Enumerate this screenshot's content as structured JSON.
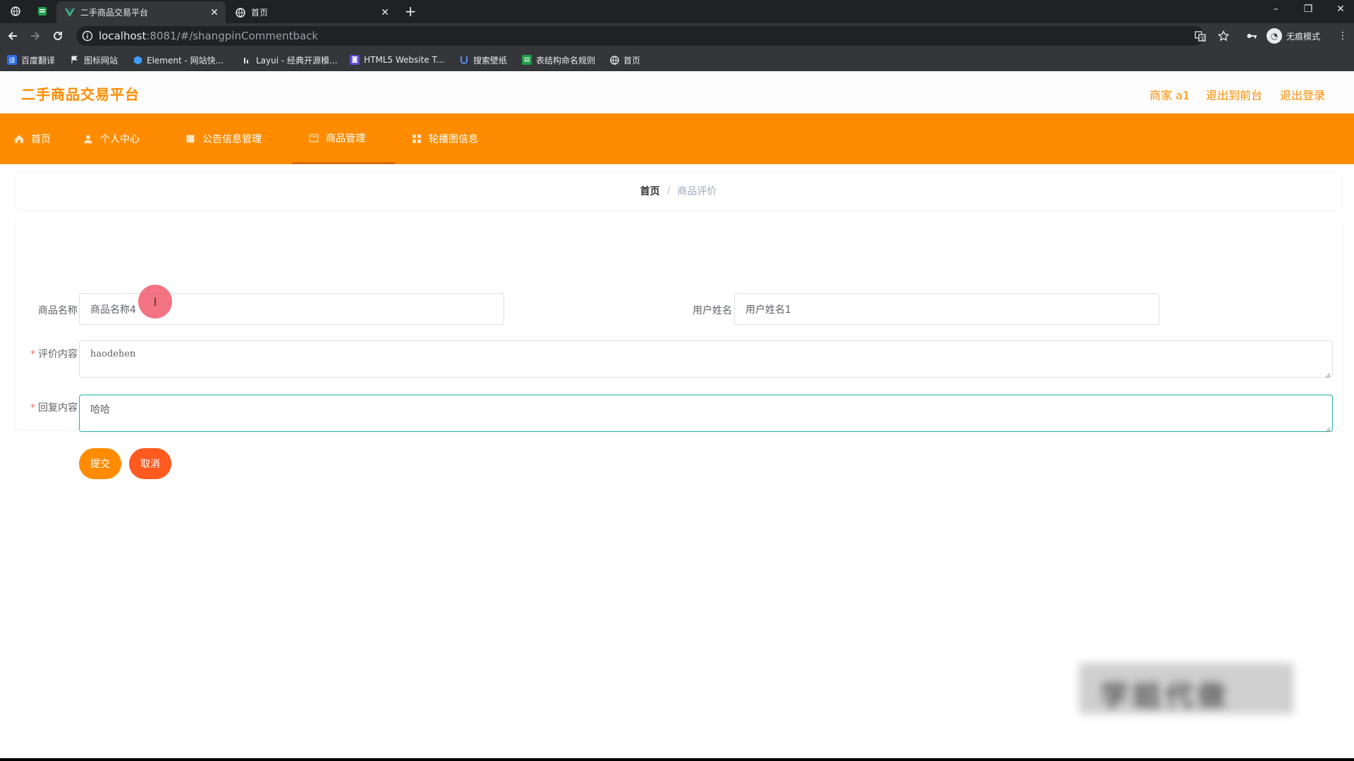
{
  "browser": {
    "tabs": [
      {
        "title": "二手商品交易平台",
        "active": true
      },
      {
        "title": "首页",
        "active": false
      }
    ],
    "url_host": "localhost",
    "url_rest": ":8081/#/shangpinCommentback",
    "incognito_label": "无痕模式",
    "bookmarks": [
      {
        "label": "百度翻译",
        "icon": "translate-icon",
        "color": "#2d6be0"
      },
      {
        "label": "图标网站",
        "icon": "flag-icon",
        "color": "#e8eaed"
      },
      {
        "label": "Element - 网站快...",
        "icon": "element-icon",
        "color": "#409eff"
      },
      {
        "label": "Layui - 经典开源模...",
        "icon": "layui-icon",
        "color": "#e8eaed"
      },
      {
        "label": "HTML5 Website T...",
        "icon": "html5-icon",
        "color": "#5b4bd8"
      },
      {
        "label": "搜索壁纸",
        "icon": "wallpaper-icon",
        "color": "#3b6fd8"
      },
      {
        "label": "表结构命名规则",
        "icon": "sheet-icon",
        "color": "#1e9e4a"
      },
      {
        "label": "首页",
        "icon": "globe-icon",
        "color": "#e8eaed"
      }
    ]
  },
  "header": {
    "brand": "二手商品交易平台",
    "user": "商家 a1",
    "to_front": "退出到前台",
    "logout": "退出登录",
    "accent": "#ff8c00"
  },
  "menu": {
    "items": [
      {
        "label": "首页",
        "icon": "home-icon"
      },
      {
        "label": "个人中心",
        "icon": "user-icon"
      },
      {
        "label": "公告信息管理",
        "icon": "notice-icon"
      },
      {
        "label": "商品管理",
        "icon": "goods-icon",
        "active": true
      },
      {
        "label": "轮播图信息",
        "icon": "carousel-icon"
      }
    ]
  },
  "breadcrumb": {
    "home": "首页",
    "separator": "/",
    "current": "商品评价"
  },
  "form": {
    "product_name_label": "商品名称",
    "product_name_value": "商品名称4",
    "user_name_label": "用户姓名",
    "user_name_value": "用户姓名1",
    "comment_label": "评价内容",
    "comment_value": "haodehen",
    "reply_label": "回复内容",
    "reply_value": "哈哈",
    "required_mark": "*",
    "submit": "提交",
    "cancel": "取消",
    "submit_color": "#ff8c00",
    "cancel_color": "#ff5a1f",
    "focus_color": "#20b2aa"
  },
  "watermark": "学姐代做"
}
